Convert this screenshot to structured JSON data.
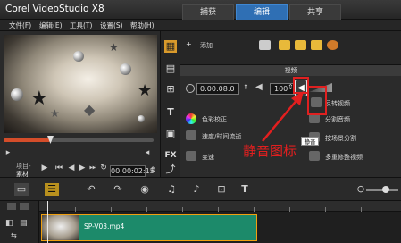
{
  "app": {
    "title": "Corel VideoStudio X8"
  },
  "mode_tabs": [
    {
      "label": "捕获"
    },
    {
      "label": "编辑",
      "active": true
    },
    {
      "label": "共享"
    }
  ],
  "menu": {
    "items": [
      "文件(F)",
      "编辑(E)",
      "工具(T)",
      "设置(S)",
      "帮助(H)"
    ]
  },
  "preview": {
    "labels": {
      "project": "项目-",
      "clip": "素材"
    },
    "timecode": "00:00:02:15",
    "progress_fraction": 0.31
  },
  "library": {
    "add_label": "添加",
    "header_label": "视频"
  },
  "options": {
    "timecode": "0:00:08:0",
    "volume": "100",
    "rows": [
      {
        "label": "色彩校正"
      },
      {
        "label": "速度/时间流逝"
      },
      {
        "label": "变速"
      }
    ],
    "right_rows": [
      {
        "label": "分割音频"
      },
      {
        "label": "按场景分割"
      },
      {
        "label": "多重修整视频"
      }
    ],
    "right_top_label": "反转视频",
    "mute_tooltip": "静音"
  },
  "annotation": {
    "callout_text": "静音图标",
    "color": "#e21f1f"
  },
  "timeline": {
    "clip_name": "SP-V03.mp4"
  }
}
